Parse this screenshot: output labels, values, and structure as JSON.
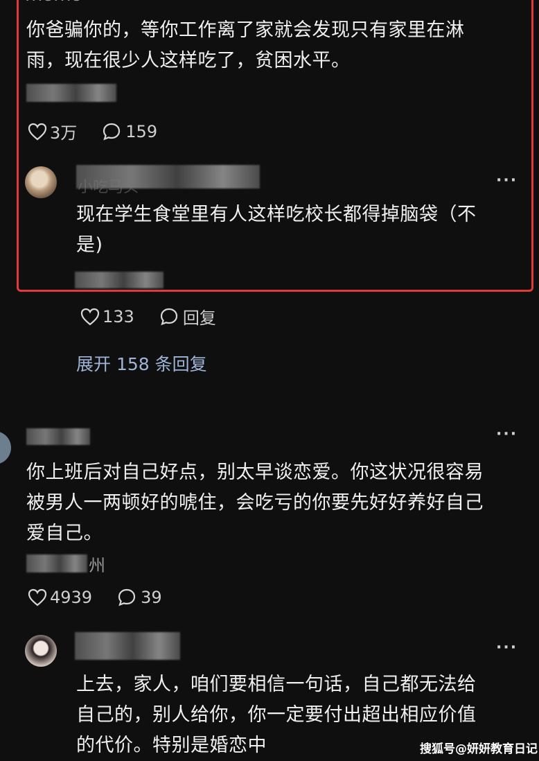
{
  "top_username": "momo",
  "comment1": {
    "text_line1": "你爸骗你的，等你工作离了家就会发现只有家里在淋",
    "text_line2": "雨，现在很少人这样吃了，贫困水平。",
    "likes": "3万",
    "replies": "159"
  },
  "reply1": {
    "username_partial": "小吃马头",
    "text_line1": "现在学生食堂里有人这样吃校长都得掉脑袋（不",
    "text_line2": "是)",
    "likes": "133",
    "reply_label": "回复",
    "more": "···"
  },
  "expand_label": "展开 158 条回复",
  "comment2": {
    "text_line1": "你上班后对自己好点，别太早谈恋爱。你这状况很容易",
    "text_line2": "被男人一两顿好的唬住，会吃亏的你要先好好养好自己",
    "text_line3": "爱自己。",
    "location_partial": "州",
    "likes": "4939",
    "replies": "39",
    "more": "···"
  },
  "reply2": {
    "text_line1": "上去，家人，咱们要相信一句话，自己都无法给",
    "text_line2": "自己的，别人给你，你一定要付出超出相应价值",
    "text_line3": "的代价。特别是婚恋中",
    "more": "···"
  },
  "watermark": "搜狐号@妍妍教育日记",
  "colors": {
    "background": "#0f0f0f",
    "highlight_border": "#e23a3a",
    "expand_link": "#9fb4d8"
  },
  "icons": [
    "heart-icon",
    "comment-bubble-icon",
    "more-icon"
  ]
}
